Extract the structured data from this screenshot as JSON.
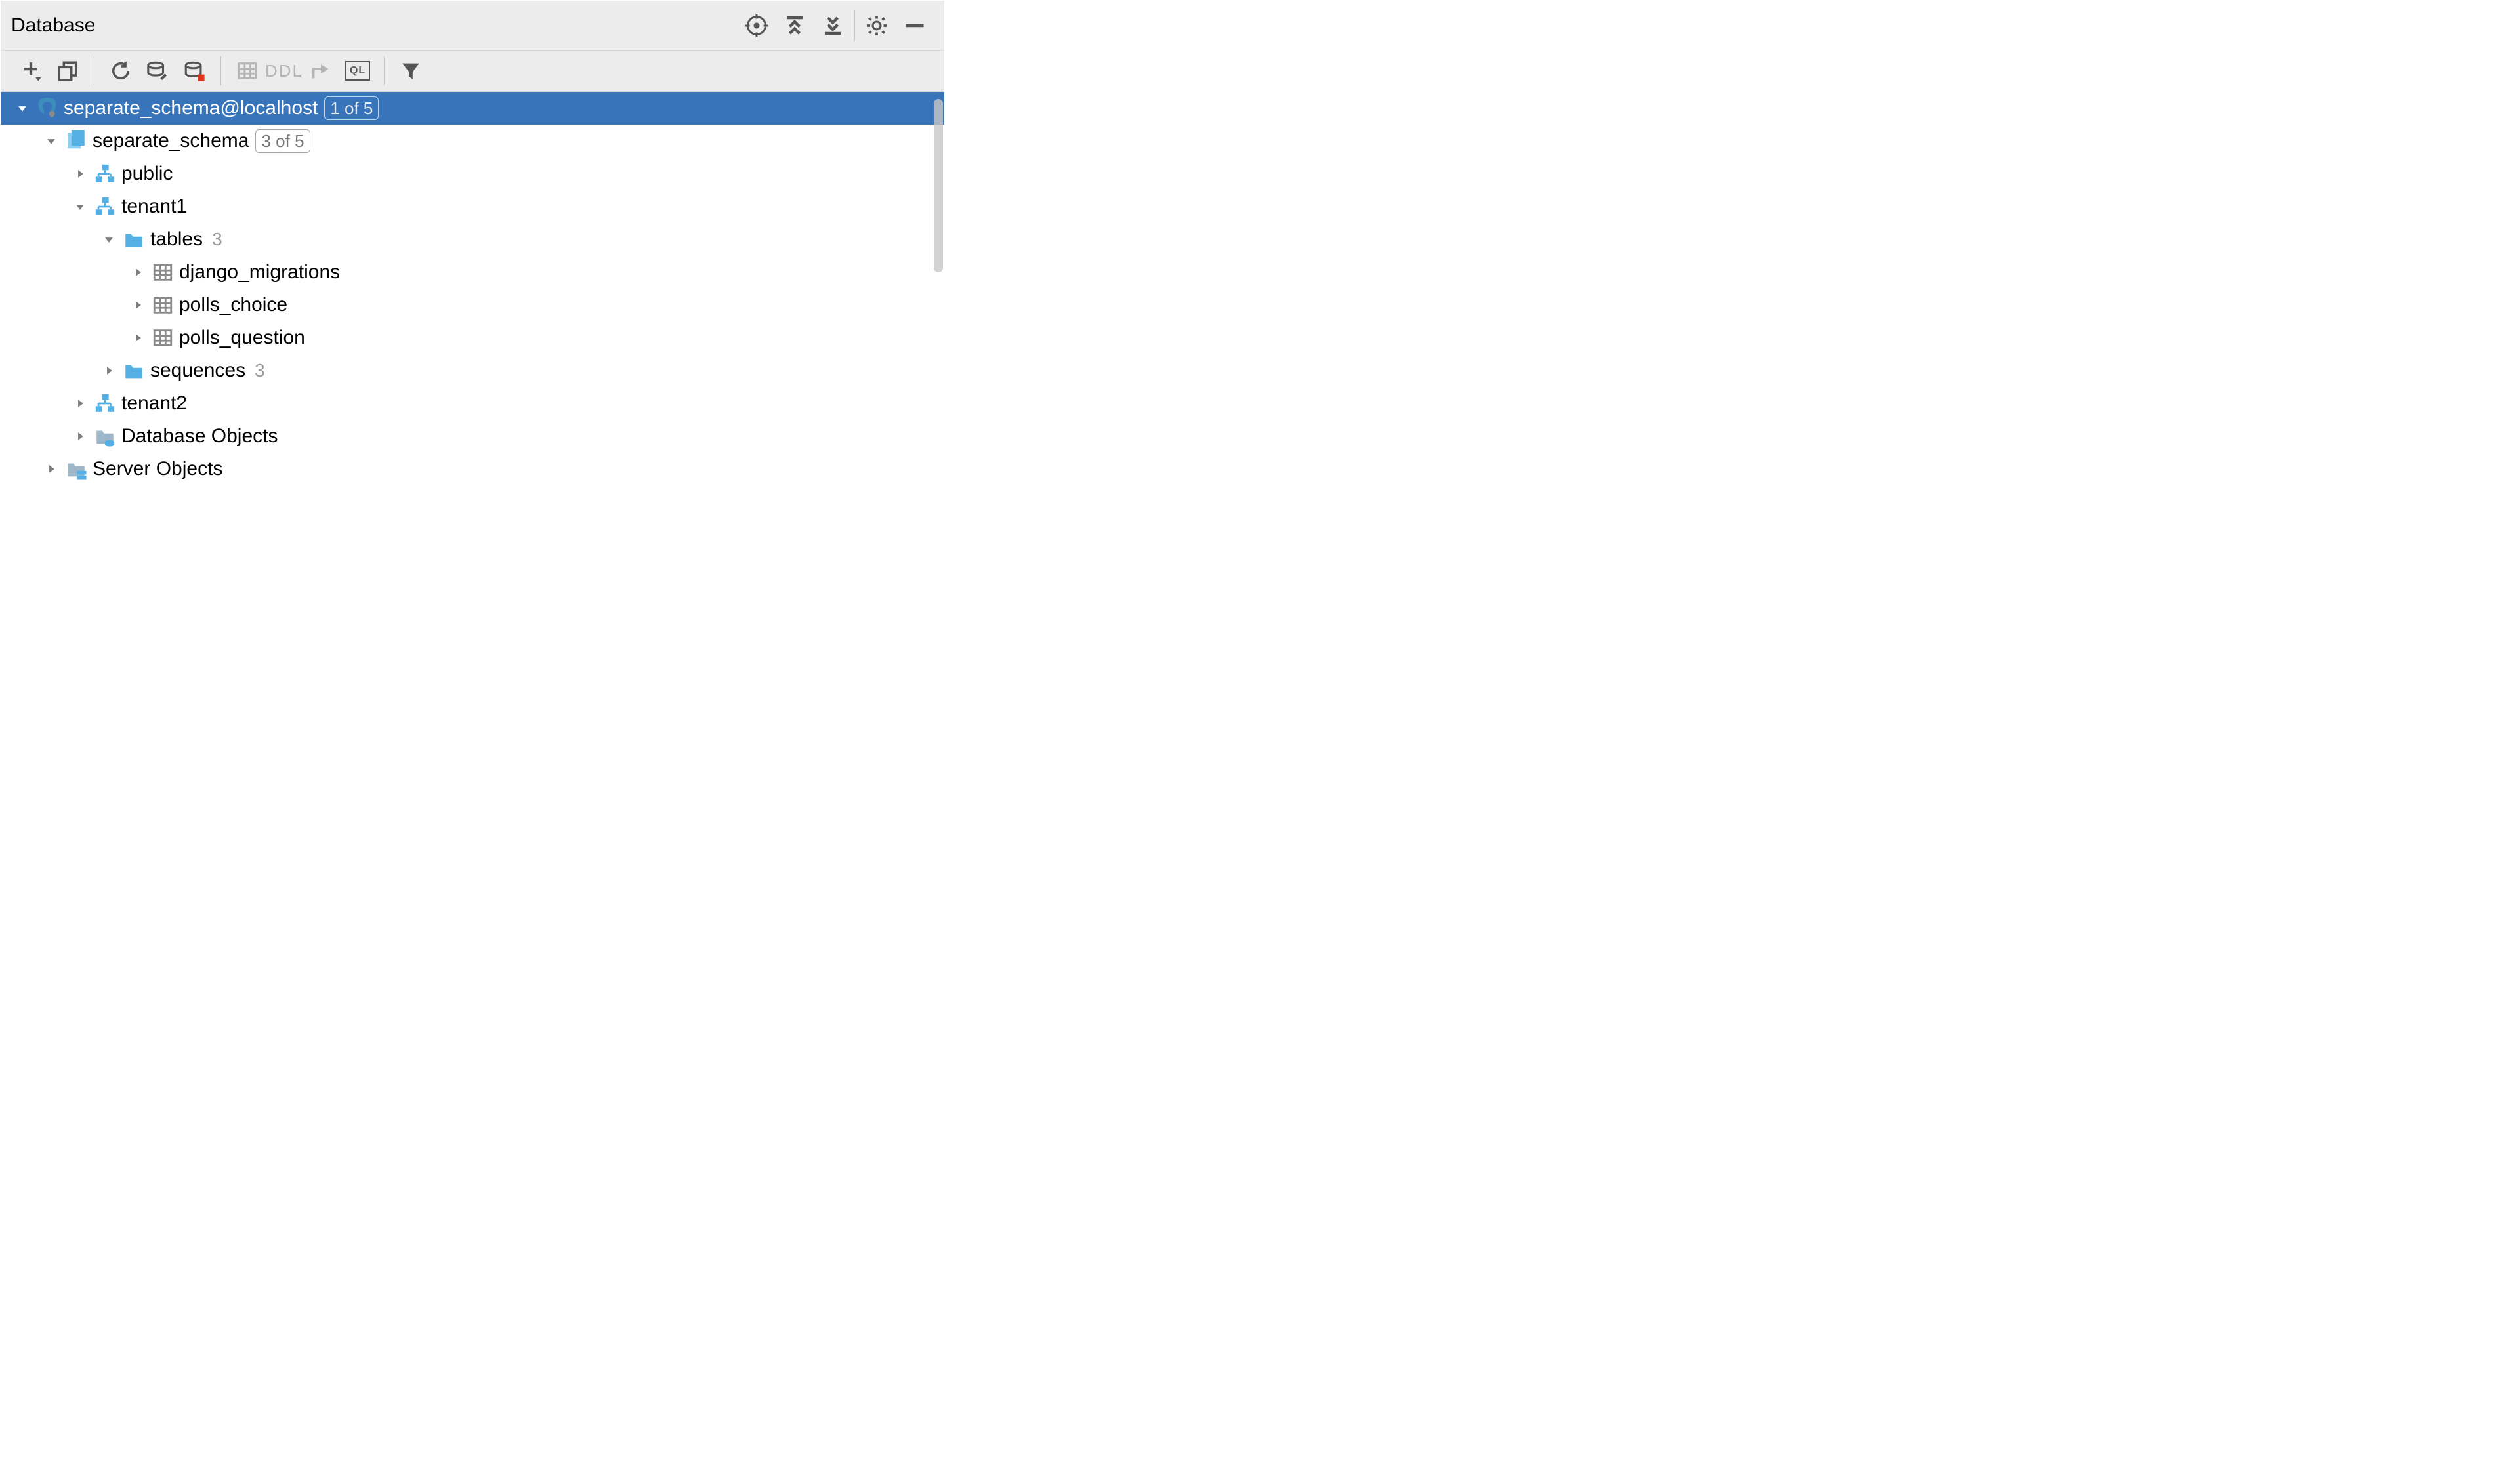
{
  "panel": {
    "title": "Database"
  },
  "toolbar": {
    "ddl": "DDL",
    "ql": "QL"
  },
  "tree": {
    "ds": {
      "label": "separate_schema@localhost",
      "badge": "1 of 5"
    },
    "db": {
      "label": "separate_schema",
      "badge": "3 of 5"
    },
    "schema_public": "public",
    "schema_t1": "tenant1",
    "tables": {
      "label": "tables",
      "count": "3"
    },
    "t_mig": "django_migrations",
    "t_choice": "polls_choice",
    "t_question": "polls_question",
    "sequences": {
      "label": "sequences",
      "count": "3"
    },
    "schema_t2": "tenant2",
    "dbobjects": "Database Objects",
    "serverobjects": "Server Objects"
  }
}
